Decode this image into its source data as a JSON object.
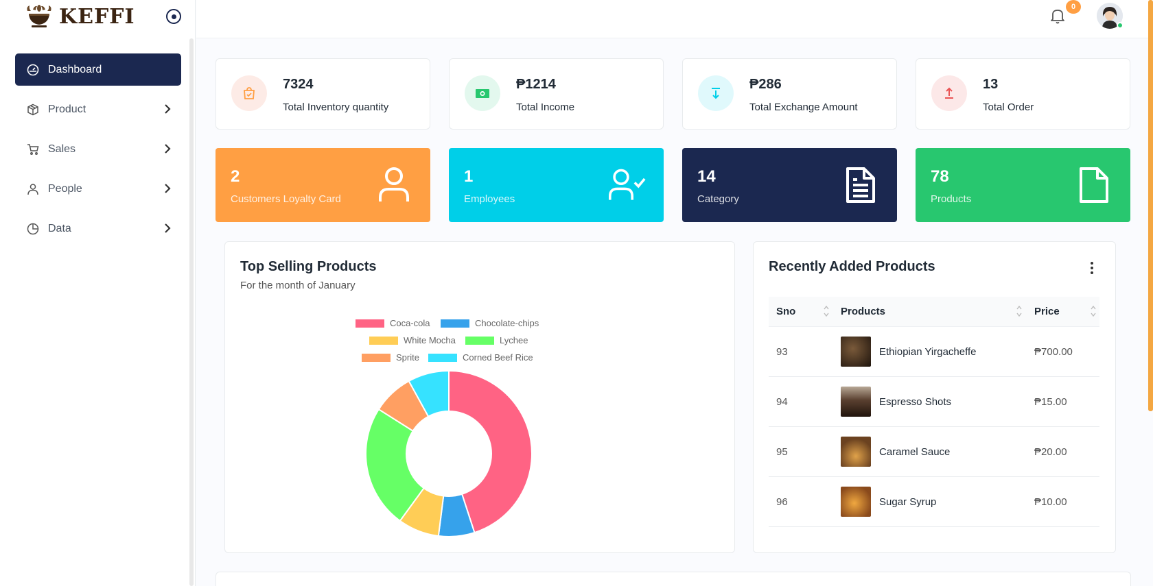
{
  "brand": {
    "name": "KEFFI"
  },
  "sidebar": {
    "items": [
      {
        "label": "Dashboard",
        "icon": "gauge-icon",
        "active": true
      },
      {
        "label": "Product",
        "icon": "box-icon"
      },
      {
        "label": "Sales",
        "icon": "cart-icon"
      },
      {
        "label": "People",
        "icon": "user-icon"
      },
      {
        "label": "Data",
        "icon": "pie-chart-icon"
      }
    ]
  },
  "header": {
    "notification_count": "0"
  },
  "stats": [
    {
      "value": "7324",
      "label": "Total Inventory quantity",
      "color": "#ff9f43",
      "icon": "bag-icon"
    },
    {
      "value": "₱1214",
      "label": "Total Income",
      "color": "#28c76f",
      "icon": "cash-icon"
    },
    {
      "value": "₱286",
      "label": "Total Exchange Amount",
      "color": "#00cfe8",
      "icon": "download-icon"
    },
    {
      "value": "13",
      "label": "Total Order",
      "color": "#ea5455",
      "icon": "upload-icon"
    }
  ],
  "color_cards": [
    {
      "value": "2",
      "label": "Customers Loyalty Card",
      "color": "#ff9f43",
      "icon": "user-icon"
    },
    {
      "value": "1",
      "label": "Employees",
      "color": "#00cfe8",
      "icon": "user-check-icon"
    },
    {
      "value": "14",
      "label": "Category",
      "color": "#1b2850",
      "icon": "file-text-icon"
    },
    {
      "value": "78",
      "label": "Products",
      "color": "#28c76f",
      "icon": "file-icon"
    }
  ],
  "top_selling": {
    "title": "Top Selling Products",
    "subtitle": "For the month of January"
  },
  "chart_data": {
    "type": "pie",
    "donut": true,
    "categories": [
      "Coca-cola",
      "Chocolate-chips",
      "White Mocha",
      "Lychee",
      "Sprite",
      "Corned Beef Rice"
    ],
    "values": [
      45,
      7,
      8,
      24,
      8,
      8
    ],
    "colors": [
      "#ff6384",
      "#36a2eb",
      "#ffcd56",
      "#66ff66",
      "#ff9f62",
      "#36e2ff"
    ],
    "legend": "top"
  },
  "recent": {
    "title": "Recently Added Products",
    "columns": [
      "Sno",
      "Products",
      "Price"
    ],
    "rows": [
      {
        "sno": "93",
        "name": "Ethiopian Yirgacheffe",
        "price": "₱700.00",
        "thumb": "#3a2a1e"
      },
      {
        "sno": "94",
        "name": "Espresso Shots",
        "price": "₱15.00",
        "thumb": "#5a4030"
      },
      {
        "sno": "95",
        "name": "Caramel Sauce",
        "price": "₱20.00",
        "thumb": "#a5682a"
      },
      {
        "sno": "96",
        "name": "Sugar Syrup",
        "price": "₱10.00",
        "thumb": "#c27a2c"
      }
    ]
  }
}
